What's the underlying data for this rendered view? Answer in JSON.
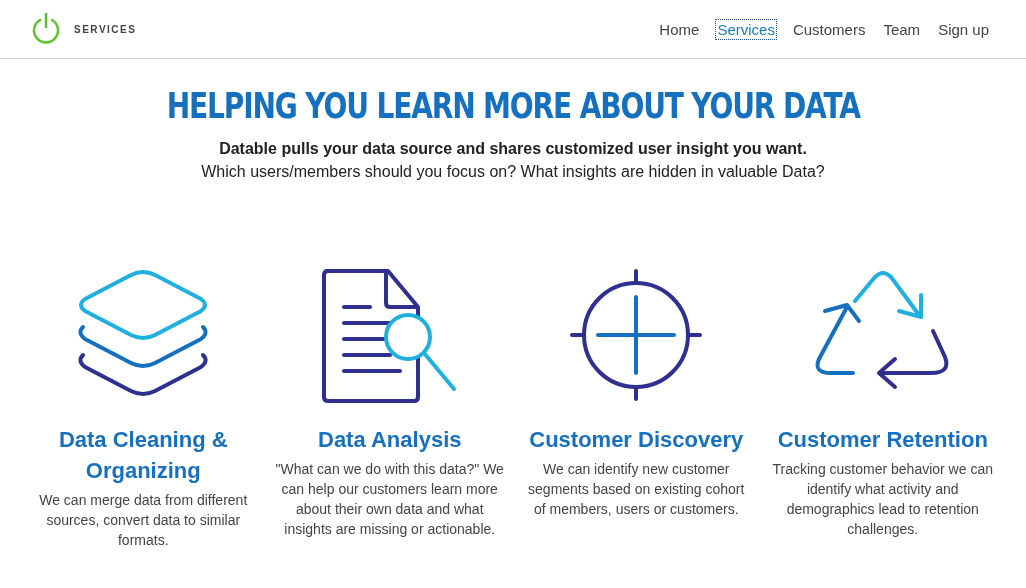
{
  "header": {
    "brand": "SERVICES",
    "nav": [
      {
        "label": "Home",
        "selected": false
      },
      {
        "label": "Services",
        "selected": true
      },
      {
        "label": "Customers",
        "selected": false
      },
      {
        "label": "Team",
        "selected": false
      },
      {
        "label": "Sign up",
        "selected": false
      }
    ]
  },
  "hero": {
    "title": "HELPING YOU LEARN MORE ABOUT YOUR DATA",
    "lead": "Datable pulls your data source and shares customized user insight you want.",
    "sub": "Which users/members should you focus on? What insights are hidden in valuable Data?"
  },
  "features": [
    {
      "kind": "layers",
      "title": "Data Cleaning & Organizing",
      "text": "We can merge data from different sources, convert data to similar formats."
    },
    {
      "kind": "document",
      "title": "Data Analysis",
      "text": "\"What can we do with this data?\" We can help our customers learn more about their own data and what insights are missing or actionable."
    },
    {
      "kind": "target",
      "title": "Customer Discovery",
      "text": "We can identify new customer segments based on existing cohort of members, users or customers."
    },
    {
      "kind": "cycle",
      "title": "Customer Retention",
      "text": "Tracking customer behavior we can identify what activity and demographics lead to retention challenges."
    }
  ]
}
